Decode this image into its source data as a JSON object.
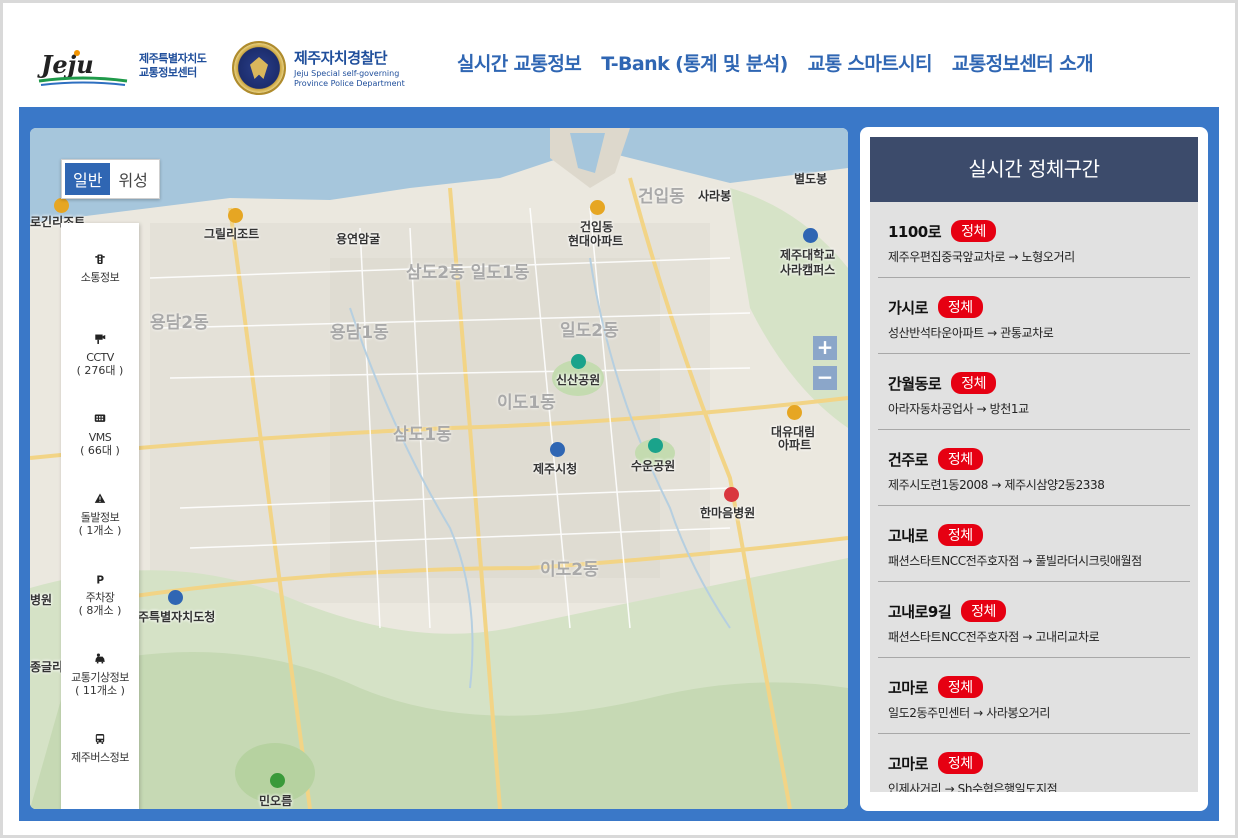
{
  "header": {
    "logo_text": "Jeju",
    "org_line1": "제주특별자치도",
    "org_line2": "교통정보센터",
    "police_name": "제주자치경찰단",
    "police_en_line1": "Jeju Special self-governing",
    "police_en_line2": "Province Police Department",
    "nav": [
      {
        "label": "실시간 교통정보"
      },
      {
        "label": "T-Bank (통계 및 분석)"
      },
      {
        "label": "교통 스마트시티"
      },
      {
        "label": "교통정보센터 소개"
      }
    ]
  },
  "map": {
    "type_toggle": {
      "general": "일반",
      "satellite": "위성",
      "active": "general"
    },
    "zoom_in": "+",
    "zoom_out": "−",
    "labels": {
      "grill": "그릴리조트",
      "yongyeon": "용연암굴",
      "geonip_dong": "건입동",
      "sarabong": "사라봉",
      "byeoldobong": "별도봉",
      "geonip_apt1": "건입동",
      "geonip_apt2": "현대아파트",
      "univ1": "제주대학교",
      "univ2": "사라캠퍼스",
      "samdo2_ildo1": "삼도2동 일도1동",
      "yongdam2": "용담2동",
      "yongdam1": "용담1동",
      "ildo2": "일도2동",
      "sinsan": "신산공원",
      "ido1": "이도1동",
      "samdo1": "삼도1동",
      "daeyu1": "대유대림",
      "daeyu2": "아파트",
      "cityhall": "제주시청",
      "suun": "수운공원",
      "hanma": "한마음병원",
      "ido2": "이도2동",
      "provhall": "주특별자치도청",
      "hospital_edge": "병원",
      "gen_edge": "종글리",
      "minoreum": "민오름",
      "logrizort": "로긴리조트"
    },
    "side_menu": [
      {
        "label": "소통정보",
        "count": "",
        "icon": "traffic-light-icon"
      },
      {
        "label": "CCTV",
        "count": "( 276대 )",
        "icon": "cctv-icon"
      },
      {
        "label": "VMS",
        "count": "( 66대 )",
        "icon": "vms-board-icon"
      },
      {
        "label": "돌발정보",
        "count": "( 1개소 )",
        "icon": "warning-icon"
      },
      {
        "label": "주차장",
        "count": "( 8개소 )",
        "icon": "parking-icon"
      },
      {
        "label": "교통기상정보",
        "count": "( 11개소 )",
        "icon": "weather-car-icon"
      },
      {
        "label": "제주버스정보",
        "count": "",
        "icon": "bus-icon"
      },
      {
        "label": "",
        "count": "",
        "icon": "cctv-icon"
      }
    ]
  },
  "panel": {
    "title": "실시간 정체구간",
    "items": [
      {
        "road": "1100로",
        "status": "정체",
        "route": "제주우편집중국앞교차로 → 노형오거리"
      },
      {
        "road": "가시로",
        "status": "정체",
        "route": "성산반석타운아파트 → 관통교차로"
      },
      {
        "road": "간월동로",
        "status": "정체",
        "route": "아라자동차공업사 → 방천1교"
      },
      {
        "road": "건주로",
        "status": "정체",
        "route": "제주시도련1동2008 → 제주시삼양2동2338"
      },
      {
        "road": "고내로",
        "status": "정체",
        "route": "패션스타트NCC전주호자점 → 풀빌라더시크릿애월점"
      },
      {
        "road": "고내로9길",
        "status": "정체",
        "route": "패션스타트NCC전주호자점 → 고내리교차로"
      },
      {
        "road": "고마로",
        "status": "정체",
        "route": "일도2동주민센터 → 사라봉오거리"
      },
      {
        "road": "고마로",
        "status": "정체",
        "route": "인제사거리 → Sh수협은행일도지점"
      }
    ]
  },
  "colors": {
    "frame_blue": "#3a78c8",
    "nav_blue": "#2f66b3",
    "panel_head": "#3c4b6b",
    "badge_red": "#e60012"
  }
}
